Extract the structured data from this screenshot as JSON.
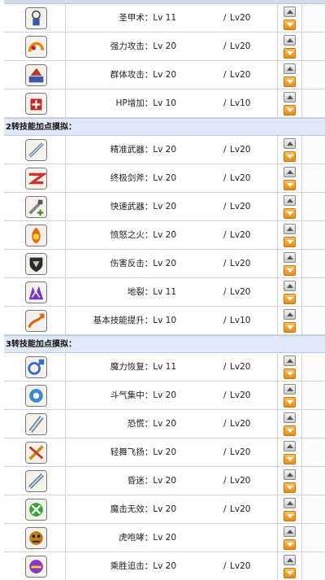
{
  "sections": [
    {
      "header": "",
      "skills": [
        {
          "name_lv": "圣甲术：Lv 11",
          "max": "Lv20",
          "icon": "holy-armor-icon",
          "color": "#3a5aa8"
        },
        {
          "name_lv": "强力攻击：Lv 20",
          "max": "Lv20",
          "icon": "power-strike-icon",
          "color": "#e08a1e"
        },
        {
          "name_lv": "群体攻击：Lv 20",
          "max": "Lv20",
          "icon": "slash-blast-icon",
          "color": "#b0402a"
        },
        {
          "name_lv": "HP增加：Lv 10",
          "max": "Lv10",
          "icon": "hp-increase-icon",
          "color": "#c0282a"
        }
      ]
    },
    {
      "header": "2转技能加点摸拟：",
      "skills": [
        {
          "name_lv": "精准武器：Lv 20",
          "max": "Lv20",
          "icon": "weapon-mastery-icon",
          "color": "#5a7a9a"
        },
        {
          "name_lv": "终极剑斧：Lv 20",
          "max": "Lv20",
          "icon": "final-attack-icon",
          "color": "#d0302a"
        },
        {
          "name_lv": "快速武器：Lv 20",
          "max": "Lv20",
          "icon": "weapon-booster-icon",
          "color": "#4a8a3a"
        },
        {
          "name_lv": "愤怒之火：Lv 20",
          "max": "Lv20",
          "icon": "rage-icon",
          "color": "#e06a1a"
        },
        {
          "name_lv": "伤害反击：Lv 20",
          "max": "Lv20",
          "icon": "power-guard-icon",
          "color": "#2a2a2a"
        },
        {
          "name_lv": "地裂：Lv 11",
          "max": "Lv20",
          "icon": "ground-smash-icon",
          "color": "#7a3ac0"
        },
        {
          "name_lv": "基本技能提升：Lv 10",
          "max": "Lv10",
          "icon": "skill-up-icon",
          "color": "#d06a1a"
        }
      ]
    },
    {
      "header": "3转技能加点摸拟：",
      "skills": [
        {
          "name_lv": "魔力恢复：Lv 11",
          "max": "Lv20",
          "icon": "mp-recovery-icon",
          "color": "#3a6ac0"
        },
        {
          "name_lv": "斗气集中：Lv 20",
          "max": "Lv20",
          "icon": "combo-attack-icon",
          "color": "#3a8ad0"
        },
        {
          "name_lv": "恐慌：Lv 20",
          "max": "Lv20",
          "icon": "panic-icon",
          "color": "#6a8aa0"
        },
        {
          "name_lv": "轻舞飞扬：Lv 20",
          "max": "Lv20",
          "icon": "brandish-icon",
          "color": "#d08a1a"
        },
        {
          "name_lv": "昏迷：Lv 20",
          "max": "Lv20",
          "icon": "coma-icon",
          "color": "#5a7aa0"
        },
        {
          "name_lv": "魔击无效：Lv 20",
          "max": "Lv20",
          "icon": "magic-crash-icon",
          "color": "#3aa03a"
        },
        {
          "name_lv": "虎咆哮：Lv 20",
          "max": "",
          "icon": "shout-icon",
          "color": "#c07a1a"
        },
        {
          "name_lv": "乘胜追击：Lv 20",
          "max": "Lv20",
          "icon": "advanced-combo-icon",
          "color": "#8a3ac0"
        }
      ]
    }
  ],
  "sep": "/"
}
